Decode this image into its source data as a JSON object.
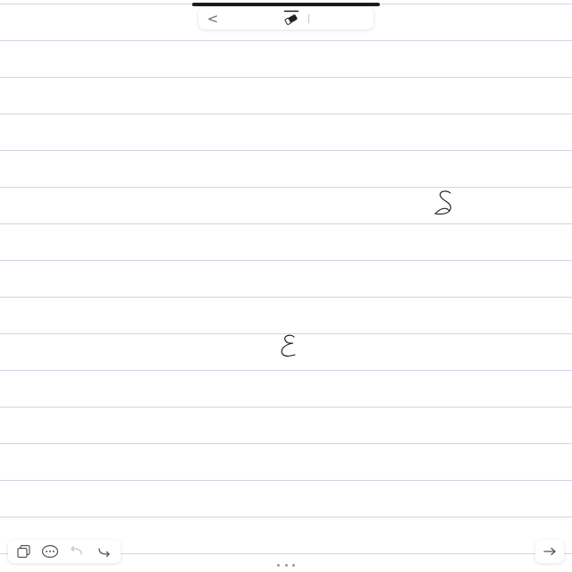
{
  "toolbar": {
    "back_glyph": "<",
    "active_tool_icon": "eraser-icon"
  },
  "handwriting": [
    {
      "name": "handwritten-mark-upper",
      "icon": "scribble"
    },
    {
      "name": "handwritten-mark-lower",
      "icon": "scribble"
    }
  ],
  "bottom_left_toolbar": {
    "buttons": [
      {
        "name": "pages-button",
        "icon": "pages-icon",
        "enabled": true
      },
      {
        "name": "more-options-button",
        "icon": "ellipsis-circle-icon",
        "enabled": true
      },
      {
        "name": "undo-button",
        "icon": "undo-icon",
        "enabled": false
      },
      {
        "name": "redo-button",
        "icon": "redo-icon",
        "enabled": true
      }
    ]
  },
  "bottom_right_toolbar": {
    "icon": "arrow-right-icon"
  },
  "colors": {
    "paper": "#ffffff",
    "rule_line": "#cfd5e4",
    "ink": "#111111",
    "icon_active": "#555555",
    "icon_disabled": "#c8c8c8"
  }
}
